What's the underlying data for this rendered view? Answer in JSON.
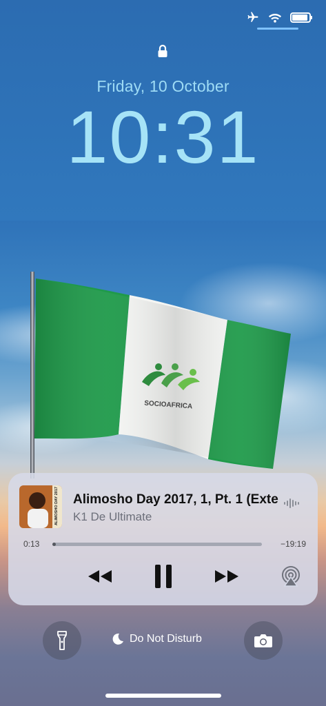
{
  "lockscreen": {
    "date": "Friday, 10 October",
    "time": "10:31"
  },
  "status_bar": {
    "icons": [
      "airplane-icon",
      "wifi-icon",
      "battery-icon"
    ],
    "battery_level": 0.9
  },
  "wallpaper": {
    "flag_logo_text": "SOCIOAFRICA",
    "flag_colors": {
      "green": "#1f9a4a",
      "white": "#f4f5f3"
    }
  },
  "now_playing": {
    "title": "Alimosho Day 2017, 1, Pt. 1 (Exte",
    "artist": "K1 De Ultimate",
    "artwork_text": "ALIMOSHO DAY 2017",
    "elapsed": "0:13",
    "remaining": "−19:19",
    "progress": 0.011,
    "controls": [
      "rewind-icon",
      "pause-icon",
      "fast-forward-icon",
      "airplay-icon"
    ]
  },
  "bottom": {
    "flashlight": "flashlight-icon",
    "dnd_label": "Do Not Disturb",
    "camera": "camera-icon"
  },
  "colors": {
    "accent_time": "#a6e3f7",
    "player_bg": "#d6dae8"
  }
}
